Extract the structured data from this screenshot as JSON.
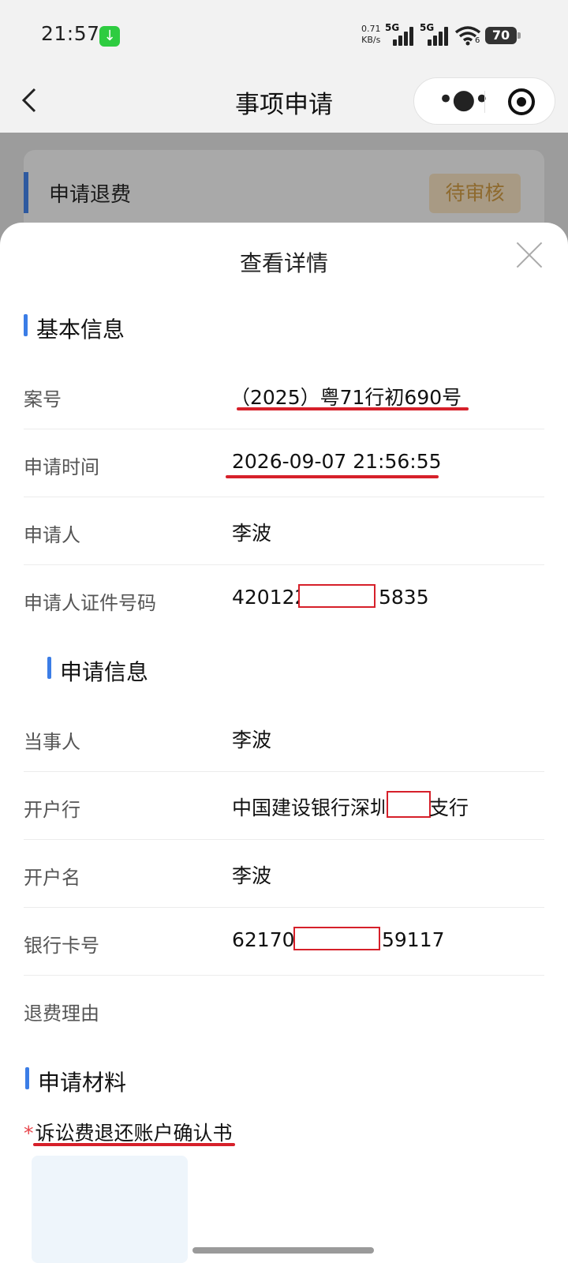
{
  "status_bar": {
    "time": "21:57",
    "net_speed_value": "0.71",
    "net_speed_unit": "KB/s",
    "signal1": "5G",
    "signal2": "5G",
    "wifi_sub": "6",
    "battery": "70"
  },
  "nav": {
    "title": "事项申请"
  },
  "background_card": {
    "title": "申请退费",
    "status": "待审核"
  },
  "sheet": {
    "title": "查看详情",
    "basic_info": {
      "heading": "基本信息",
      "rows": [
        {
          "label": "案号",
          "value": "（2025）粤71行初690号"
        },
        {
          "label": "申请时间",
          "value": "2026-09-07 21:56:55"
        },
        {
          "label": "申请人",
          "value": "李波"
        },
        {
          "label": "申请人证件号码",
          "value_prefix": "420122",
          "value_suffix": "5835"
        }
      ]
    },
    "apply_info": {
      "heading": "申请信息",
      "rows": [
        {
          "label": "当事人",
          "value": "李波"
        },
        {
          "label": "开户行",
          "value_prefix": "中国建设银行深圳",
          "value_suffix": "支行"
        },
        {
          "label": "开户名",
          "value": "李波"
        },
        {
          "label": "银行卡号",
          "value_prefix": "621700",
          "value_suffix": "59117"
        },
        {
          "label": "退费理由",
          "value": ""
        }
      ]
    },
    "materials": {
      "heading": "申请材料",
      "required_mark": "*",
      "item_label": "诉讼费退还账户确认书"
    }
  },
  "colors": {
    "accent": "#3b7de6",
    "redaction": "#d6202a",
    "pending": "#8e6a2e"
  }
}
